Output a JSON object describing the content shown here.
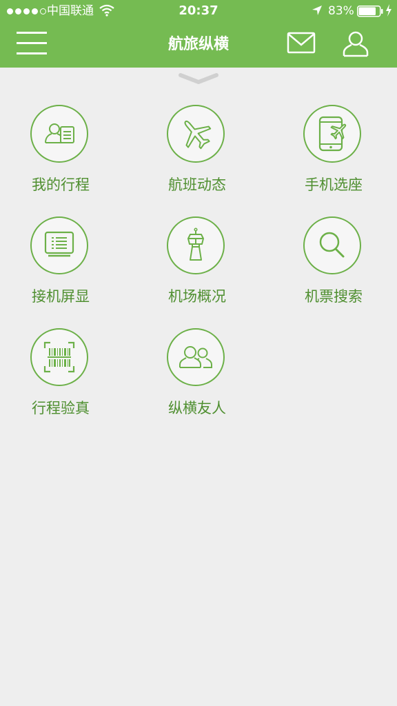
{
  "status_bar": {
    "carrier": "中国联通",
    "time": "20:37",
    "battery": "83%",
    "battery_level": 0.83,
    "signal_bars_filled": 4,
    "signal_bars_total": 5
  },
  "header": {
    "title": "航旅纵横",
    "menu_icon": "hamburger-menu-icon",
    "mail_icon": "mail-icon",
    "user_icon": "user-icon"
  },
  "colors": {
    "header_bg": "#75bb52",
    "accent": "#6cb048",
    "label": "#4f8f30",
    "page_bg": "#eeeeee"
  },
  "grid": [
    {
      "label": "我的行程",
      "icon": "id-card-icon"
    },
    {
      "label": "航班动态",
      "icon": "airplane-icon"
    },
    {
      "label": "手机选座",
      "icon": "phone-airplane-icon"
    },
    {
      "label": "接机屏显",
      "icon": "display-screen-icon"
    },
    {
      "label": "机场概况",
      "icon": "control-tower-icon"
    },
    {
      "label": "机票搜索",
      "icon": "search-icon"
    },
    {
      "label": "行程验真",
      "icon": "barcode-scan-icon"
    },
    {
      "label": "纵横友人",
      "icon": "friends-icon"
    }
  ]
}
